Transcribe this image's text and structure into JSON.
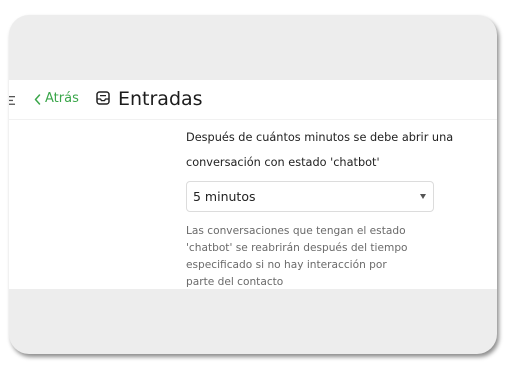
{
  "header": {
    "back_label": "Atrás",
    "title": "Entradas",
    "menu_icon": "menu-icon",
    "back_icon": "chevron-left-icon",
    "title_icon": "inbox-icon"
  },
  "setting": {
    "label": "Después de cuántos minutos se debe abrir una conversación con estado 'chatbot'",
    "selected": "5 minutos",
    "help_text": "Las conversaciones que tengan el estado 'chatbot' se reabrirán después del tiempo especificado si no hay interacción por parte del contacto"
  },
  "colors": {
    "accent": "#3aa64a",
    "frame_bg": "#ededed",
    "panel_bg": "#ffffff"
  }
}
